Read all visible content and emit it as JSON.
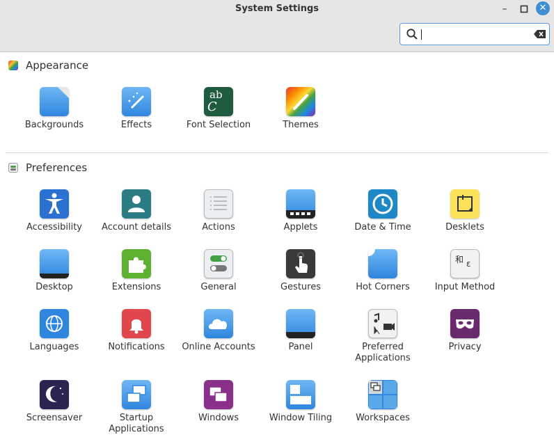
{
  "window": {
    "title": "System Settings",
    "minimize": "–",
    "maximize": "□",
    "close": "✕"
  },
  "search": {
    "value": "",
    "placeholder": ""
  },
  "sections": {
    "appearance": {
      "title": "Appearance"
    },
    "preferences": {
      "title": "Preferences"
    }
  },
  "appearance": {
    "backgrounds": "Backgrounds",
    "effects": "Effects",
    "font_selection": "Font Selection",
    "themes": "Themes"
  },
  "preferences": {
    "accessibility": "Accessibility",
    "account_details": "Account details",
    "actions": "Actions",
    "applets": "Applets",
    "date_time": "Date & Time",
    "desklets": "Desklets",
    "desktop": "Desktop",
    "extensions": "Extensions",
    "general": "General",
    "gestures": "Gestures",
    "hot_corners": "Hot Corners",
    "input_method": "Input Method",
    "languages": "Languages",
    "notifications": "Notifications",
    "online_accounts": "Online Accounts",
    "panel": "Panel",
    "preferred_applications": "Preferred Applications",
    "privacy": "Privacy",
    "screensaver": "Screensaver",
    "startup_applications": "Startup Applications",
    "windows": "Windows",
    "window_tiling": "Window Tiling",
    "workspaces": "Workspaces"
  },
  "icon_glyphs": {
    "font_selection": "ab",
    "font_selection_c": "C",
    "input_method_1": "和",
    "input_method_2": "ε"
  }
}
